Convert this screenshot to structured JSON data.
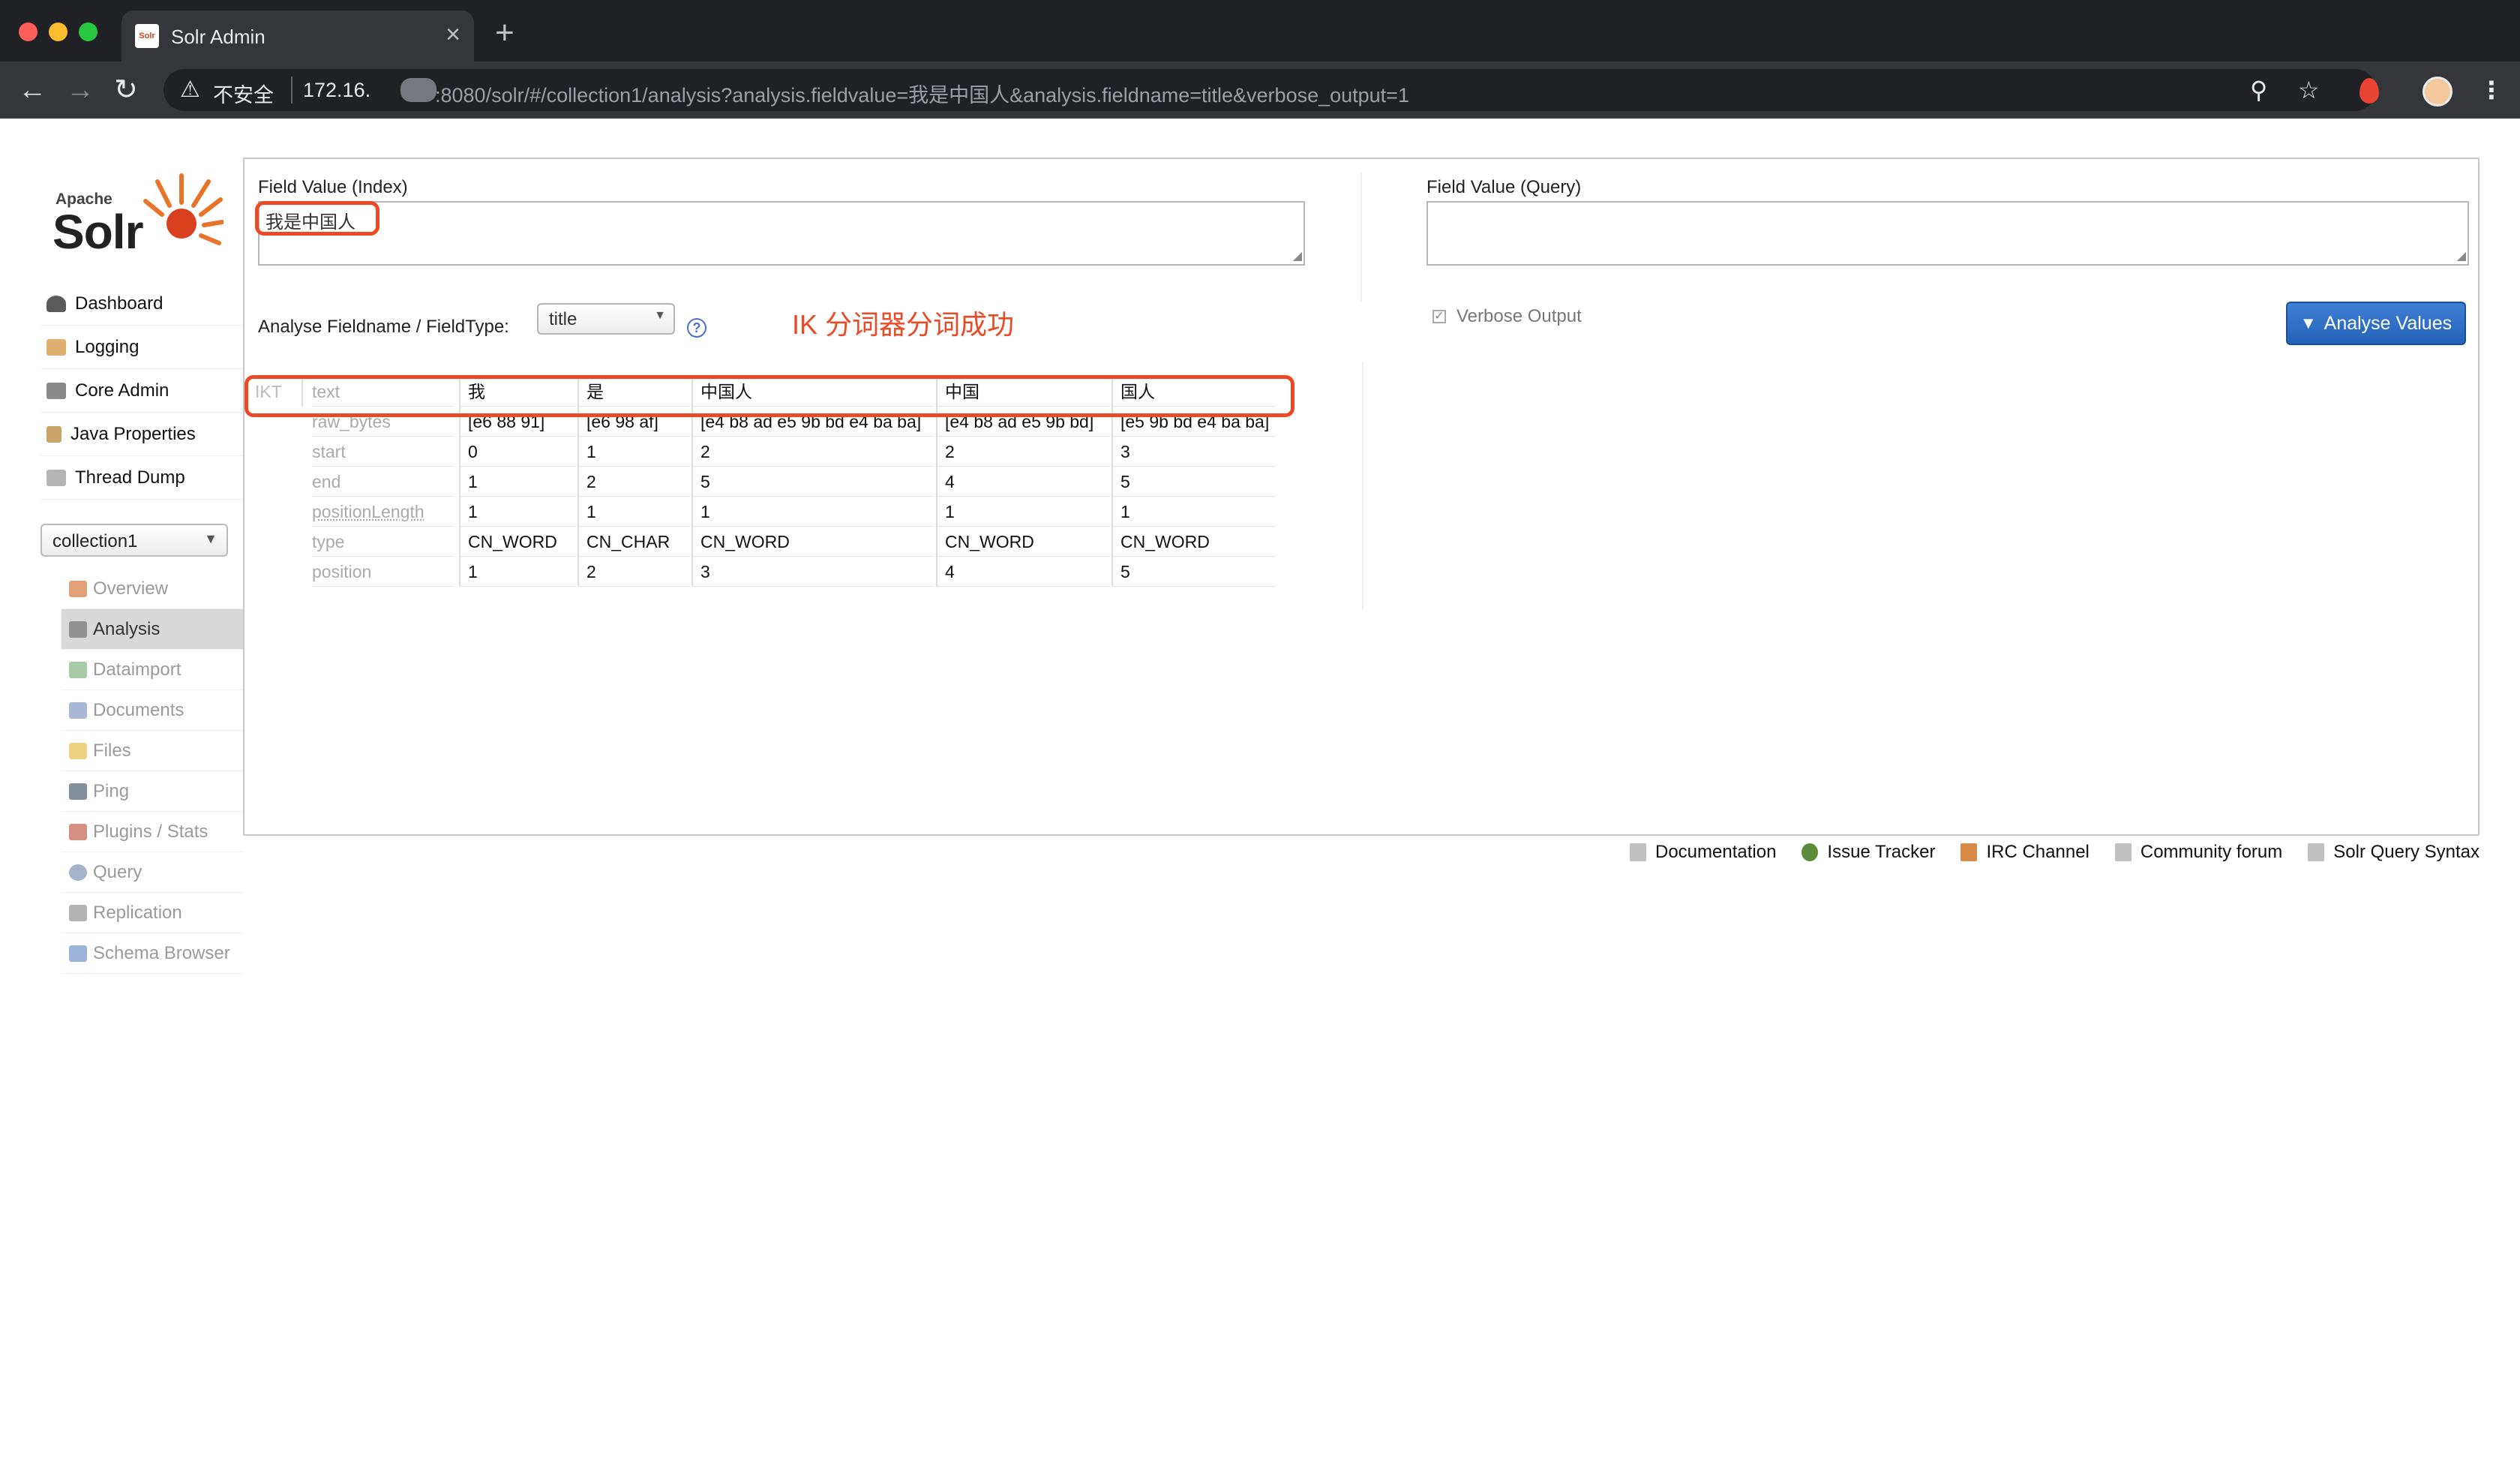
{
  "browser": {
    "tab_title": "Solr Admin",
    "tab_favicon_text": "Solr",
    "insecure_label": "不安全",
    "url_host": "172.16.",
    "url_path": ":8080/solr/#/collection1/analysis?analysis.fieldvalue=我是中国人&analysis.fieldname=title&verbose_output=1"
  },
  "logo": {
    "apache": "Apache",
    "solr": "Solr"
  },
  "sidebar": {
    "items": [
      {
        "label": "Dashboard",
        "icon": "dashboard-icon",
        "color": "#5a5a5a"
      },
      {
        "label": "Logging",
        "icon": "logging-icon",
        "color": "#e0b070"
      },
      {
        "label": "Core Admin",
        "icon": "core-admin-icon",
        "color": "#8a8a8a"
      },
      {
        "label": "Java Properties",
        "icon": "java-icon",
        "color": "#c9a56a"
      },
      {
        "label": "Thread Dump",
        "icon": "thread-dump-icon",
        "color": "#b5b5b5"
      }
    ],
    "core_selector": "collection1",
    "core_items": [
      {
        "label": "Overview",
        "icon": "overview-icon",
        "color": "#d9824a"
      },
      {
        "label": "Analysis",
        "icon": "analysis-icon",
        "color": "#777777"
      },
      {
        "label": "Dataimport",
        "icon": "dataimport-icon",
        "color": "#8ab88a"
      },
      {
        "label": "Documents",
        "icon": "documents-icon",
        "color": "#8aa2c8"
      },
      {
        "label": "Files",
        "icon": "files-icon",
        "color": "#e8c35a"
      },
      {
        "label": "Ping",
        "icon": "ping-icon",
        "color": "#5a6a7a"
      },
      {
        "label": "Plugins / Stats",
        "icon": "plugins-icon",
        "color": "#c86a5a"
      },
      {
        "label": "Query",
        "icon": "query-icon",
        "color": "#8a9ab8"
      },
      {
        "label": "Replication",
        "icon": "replication-icon",
        "color": "#9a9a9a"
      },
      {
        "label": "Schema Browser",
        "icon": "schema-browser-icon",
        "color": "#7a9ac8"
      }
    ]
  },
  "analysis": {
    "index_label": "Field Value (Index)",
    "index_value": "我是中国人",
    "query_label": "Field Value (Query)",
    "query_value": "",
    "fieldname_label": "Analyse Fieldname / FieldType:",
    "fieldname_value": "title",
    "annotation": "IK 分词器分词成功",
    "verbose_label": "Verbose Output",
    "analyse_button": "Analyse Values",
    "tokenizer": "IKT",
    "row_names": [
      "text",
      "raw_bytes",
      "start",
      "end",
      "positionLength",
      "type",
      "position"
    ],
    "tokens": [
      {
        "text": "我",
        "raw_bytes": "[e6 88 91]",
        "start": "0",
        "end": "1",
        "positionLength": "1",
        "type": "CN_WORD",
        "position": "1"
      },
      {
        "text": "是",
        "raw_bytes": "[e6 98 af]",
        "start": "1",
        "end": "2",
        "positionLength": "1",
        "type": "CN_CHAR",
        "position": "2"
      },
      {
        "text": "中国人",
        "raw_bytes": "[e4 b8 ad e5 9b bd e4 ba ba]",
        "start": "2",
        "end": "5",
        "positionLength": "1",
        "type": "CN_WORD",
        "position": "3"
      },
      {
        "text": "中国",
        "raw_bytes": "[e4 b8 ad e5 9b bd]",
        "start": "2",
        "end": "4",
        "positionLength": "1",
        "type": "CN_WORD",
        "position": "4"
      },
      {
        "text": "国人",
        "raw_bytes": "[e5 9b bd e4 ba ba]",
        "start": "3",
        "end": "5",
        "positionLength": "1",
        "type": "CN_WORD",
        "position": "5"
      }
    ]
  },
  "footer": [
    {
      "label": "Documentation",
      "icon": "documentation-icon",
      "color": "#c0c0c0"
    },
    {
      "label": "Issue Tracker",
      "icon": "issue-tracker-icon",
      "color": "#5a8a3a"
    },
    {
      "label": "IRC Channel",
      "icon": "irc-channel-icon",
      "color": "#d98a4a"
    },
    {
      "label": "Community forum",
      "icon": "community-forum-icon",
      "color": "#c0c0c0"
    },
    {
      "label": "Solr Query Syntax",
      "icon": "query-syntax-icon",
      "color": "#c0c0c0"
    }
  ],
  "accent_color": "#ea4a25"
}
